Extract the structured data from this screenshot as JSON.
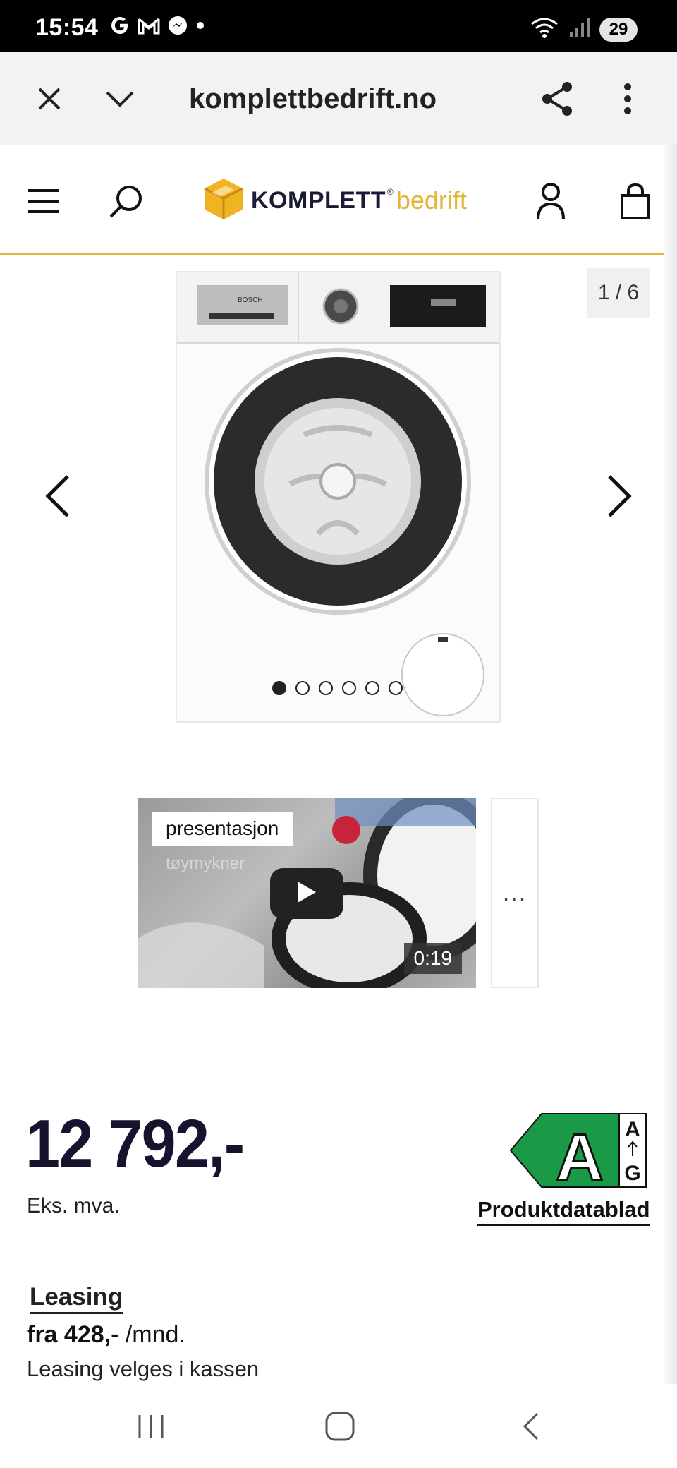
{
  "status_bar": {
    "time": "15:54",
    "battery": "29",
    "app_icons": [
      "google-icon",
      "gmail-icon",
      "messenger-icon",
      "notification-dot-icon"
    ]
  },
  "browser": {
    "url": "komplettbedrift.no"
  },
  "header": {
    "logo_name": "KOMPLETT",
    "logo_reg": "®",
    "logo_suffix": "bedrift",
    "accent_color": "#e3b53a",
    "brand_color": "#1c1b36"
  },
  "gallery": {
    "counter": "1 / 6",
    "image_count": 6,
    "active_index": 0,
    "brand_on_panel": "BOSCH"
  },
  "video": {
    "label": "presentasjon",
    "caption": "tøymykner",
    "duration": "0:19",
    "more_label": "..."
  },
  "price": {
    "amount": "12 792,-",
    "note": "Eks. mva.",
    "energy_class": "A",
    "energy_top": "A",
    "energy_bottom": "G",
    "energy_color": "#1a9a46",
    "datasheet_link": "Produktdatablad"
  },
  "leasing": {
    "title": "Leasing",
    "price_amount": "fra 428,-",
    "price_unit": " /mnd.",
    "note": "Leasing velges i kassen"
  }
}
